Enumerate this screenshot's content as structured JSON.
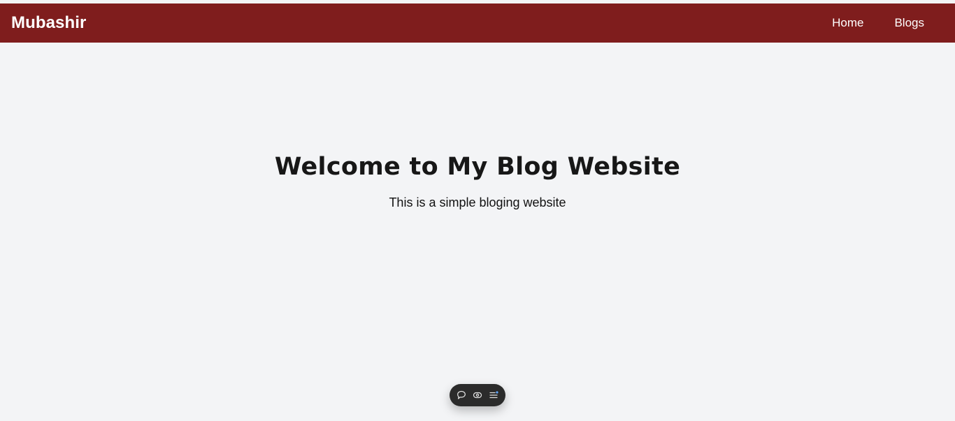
{
  "navbar": {
    "brand": "Mubashir",
    "links": [
      {
        "label": "Home"
      },
      {
        "label": "Blogs"
      }
    ],
    "background_color": "#7f1d1d"
  },
  "hero": {
    "title": "Welcome to My Blog Website",
    "subtitle": "This is a simple bloging website"
  },
  "floating_toolbar": {
    "buttons": [
      {
        "icon": "comment-icon"
      },
      {
        "icon": "eye-icon"
      },
      {
        "icon": "list-menu-icon"
      }
    ],
    "background_color": "#2b2b2b",
    "accent_color": "#60a5fa"
  },
  "page": {
    "background_color": "#f3f4f6"
  }
}
